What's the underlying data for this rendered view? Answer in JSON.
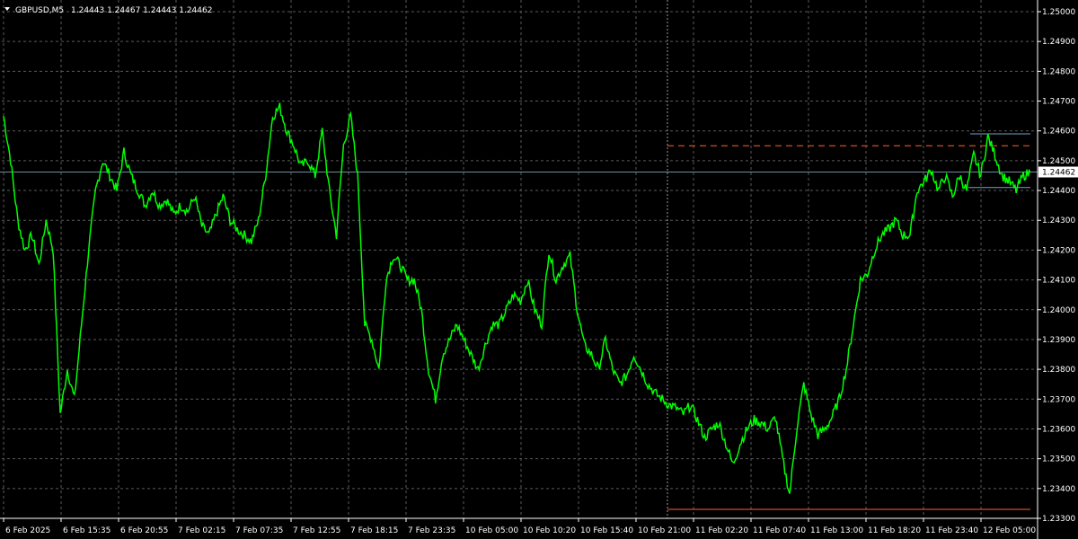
{
  "header": {
    "symbol": "GBPUSD,M5",
    "ohlc": "1.24443 1.24467 1.24443 1.24462",
    "dropdown_icon": "triangle-down-icon"
  },
  "colors": {
    "background": "#000000",
    "grid": "#5a5a5a",
    "line": "#00ff00",
    "axis_text": "#ffffff",
    "bid_line": "#6f8f9f",
    "stop_line": "#ff6030",
    "target_dashed": "#ff6030",
    "channel": "#6fa8c8"
  },
  "current_price_tag": "1.24462",
  "chart_data": {
    "type": "line",
    "title": "GBPUSD,M5",
    "xlabel": "",
    "ylabel": "",
    "ylim": [
      1.233,
      1.2505
    ],
    "grid": true,
    "yticks": [
      "1.25000",
      "1.24900",
      "1.24800",
      "1.24700",
      "1.24600",
      "1.24500",
      "1.24400",
      "1.24300",
      "1.24200",
      "1.24100",
      "1.24000",
      "1.23900",
      "1.23800",
      "1.23700",
      "1.23600",
      "1.23500",
      "1.23400",
      "1.23300"
    ],
    "ytick_values": [
      1.25,
      1.249,
      1.248,
      1.247,
      1.246,
      1.245,
      1.244,
      1.243,
      1.242,
      1.241,
      1.24,
      1.239,
      1.238,
      1.237,
      1.236,
      1.235,
      1.234,
      1.233
    ],
    "xticks": [
      "6 Feb 2025",
      "6 Feb 15:35",
      "6 Feb 20:55",
      "7 Feb 02:15",
      "7 Feb 07:35",
      "7 Feb 12:55",
      "7 Feb 18:15",
      "7 Feb 23:35",
      "10 Feb 05:00",
      "10 Feb 10:20",
      "10 Feb 15:40",
      "10 Feb 21:00",
      "11 Feb 02:20",
      "11 Feb 07:40",
      "11 Feb 13:00",
      "11 Feb 18:20",
      "11 Feb 23:40",
      "12 Feb 05:00"
    ],
    "series": [
      {
        "values": [
          1.2465,
          1.245,
          1.243,
          1.242,
          1.2425,
          1.2415,
          1.243,
          1.242,
          1.2365,
          1.238,
          1.237,
          1.2395,
          1.242,
          1.244,
          1.245,
          1.2445,
          1.244,
          1.2453,
          1.2445,
          1.244,
          1.2435,
          1.244,
          1.2435,
          1.2437,
          1.2432,
          1.2435,
          1.2433,
          1.2438,
          1.2428,
          1.2425,
          1.2432,
          1.2438,
          1.243,
          1.2427,
          1.2425,
          1.2423,
          1.243,
          1.2445,
          1.2465,
          1.2468,
          1.246,
          1.2455,
          1.2448,
          1.245,
          1.2445,
          1.246,
          1.244,
          1.2425,
          1.2455,
          1.2465,
          1.2445,
          1.2395,
          1.239,
          1.238,
          1.241,
          1.2418,
          1.2415,
          1.241,
          1.241,
          1.24,
          1.238,
          1.237,
          1.2385,
          1.239,
          1.2395,
          1.239,
          1.2385,
          1.238,
          1.2388,
          1.2395,
          1.2395,
          1.24,
          1.2405,
          1.2403,
          1.241,
          1.24,
          1.2395,
          1.242,
          1.241,
          1.2415,
          1.2418,
          1.24,
          1.2388,
          1.2385,
          1.238,
          1.239,
          1.238,
          1.2375,
          1.2378,
          1.2385,
          1.238,
          1.2375,
          1.2372,
          1.237,
          1.2368,
          1.2367,
          1.2365,
          1.2368,
          1.2363,
          1.2357,
          1.236,
          1.2362,
          1.2355,
          1.2348,
          1.2355,
          1.236,
          1.2363,
          1.2362,
          1.236,
          1.2364,
          1.235,
          1.2338,
          1.236,
          1.2375,
          1.2365,
          1.2358,
          1.236,
          1.2364,
          1.237,
          1.238,
          1.2395,
          1.241,
          1.2412,
          1.242,
          1.2425,
          1.2427,
          1.243,
          1.2425,
          1.2425,
          1.244,
          1.2443,
          1.2447,
          1.244,
          1.2445,
          1.2438,
          1.2445,
          1.244,
          1.2452,
          1.2445,
          1.2458,
          1.2452,
          1.2445,
          1.2443,
          1.244,
          1.2445,
          1.2446
        ]
      }
    ],
    "levels": {
      "bid": 1.24462,
      "stop": 1.2333,
      "target": 1.2455,
      "channel_upper": 1.2459,
      "channel_lower": 1.2441
    }
  }
}
